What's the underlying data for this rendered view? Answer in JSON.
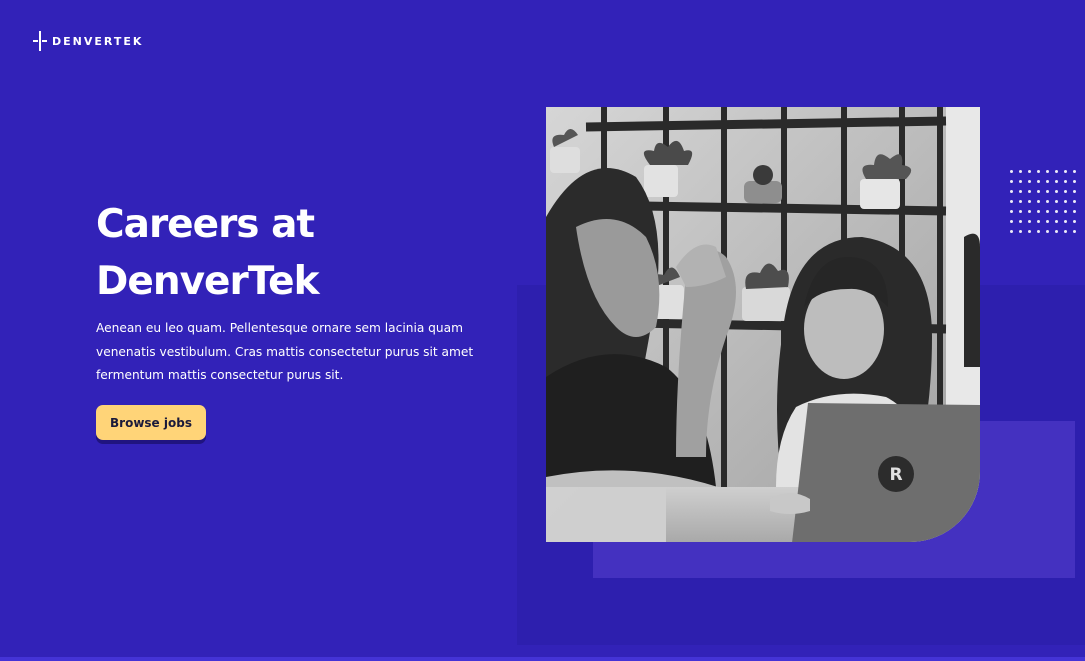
{
  "brand": {
    "name": "DENVERTEK"
  },
  "hero": {
    "title_line1": "Careers at",
    "title_line2": "DenverTek",
    "description": "Aenean eu leo quam. Pellentesque ornare sem lacinia quam venenatis vestibulum. Cras mattis consectetur purus sit amet fermentum mattis consectetur purus sit.",
    "cta_label": "Browse jobs"
  },
  "photo": {
    "laptop_logo": "R"
  },
  "colors": {
    "background": "#3222b8",
    "panel_back": "#2d1fae",
    "panel_mid": "#4431c0",
    "cta": "#ffd478",
    "text": "#ffffff"
  },
  "icons": {
    "logo_mark": "crosshair-logo-icon",
    "dot_grid": "dot-grid-decoration"
  }
}
